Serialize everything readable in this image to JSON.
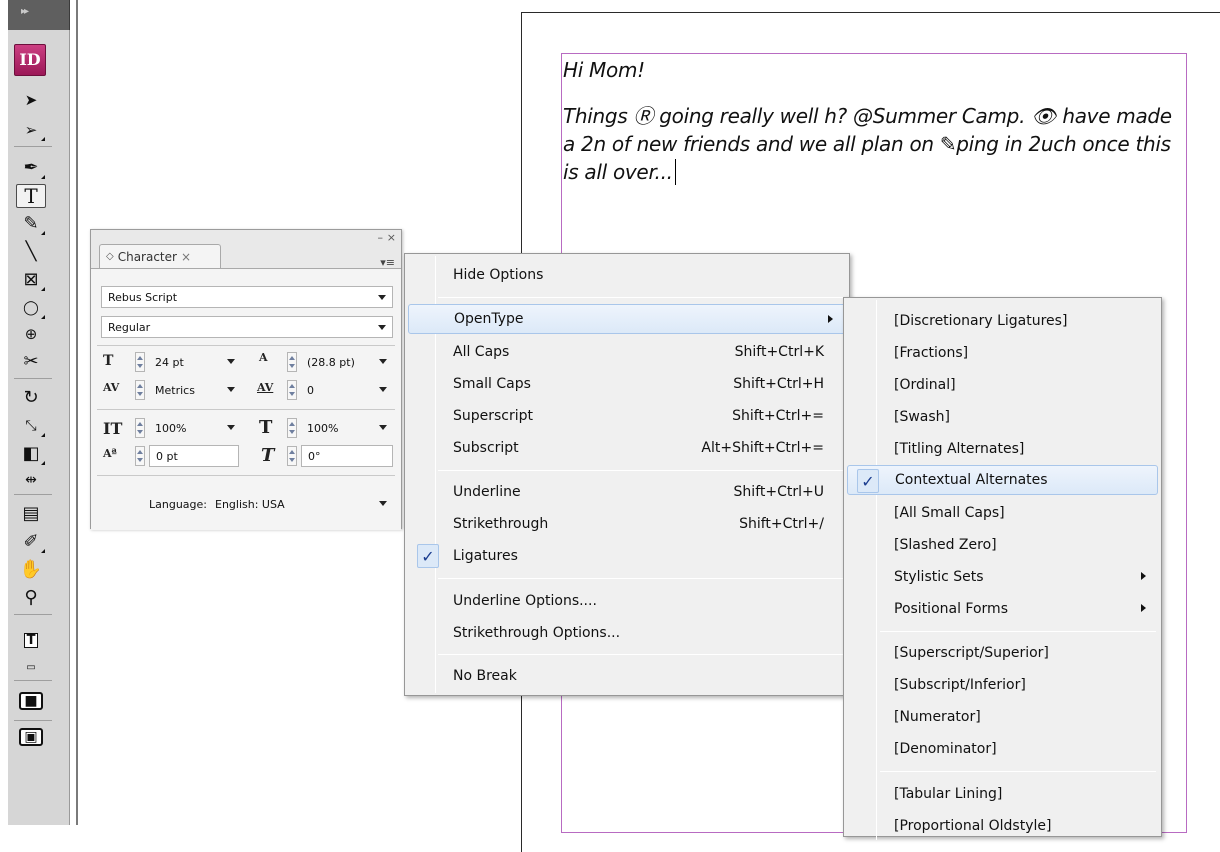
{
  "toolbar": {
    "collapse_glyph": "▸▸",
    "app_logo": "ID",
    "tools": [
      {
        "name": "selection-tool",
        "glyph": "➤"
      },
      {
        "name": "direct-selection-tool",
        "glyph": "➢"
      },
      {
        "name": "pen-tool",
        "glyph": "✒"
      },
      {
        "name": "type-tool",
        "glyph": "T"
      },
      {
        "name": "pencil-tool",
        "glyph": "✎"
      },
      {
        "name": "line-tool",
        "glyph": "╲"
      },
      {
        "name": "rectangle-frame-tool",
        "glyph": "⊠"
      },
      {
        "name": "ellipse-tool",
        "glyph": "◯"
      },
      {
        "name": "scissors-tool",
        "glyph": "✂"
      },
      {
        "name": "rotate-tool",
        "glyph": "↻"
      },
      {
        "name": "gradient-tool",
        "glyph": "◧"
      },
      {
        "name": "note-tool",
        "glyph": "▤"
      },
      {
        "name": "eyedropper-tool",
        "glyph": "✐"
      },
      {
        "name": "hand-tool",
        "glyph": "✋"
      },
      {
        "name": "zoom-tool",
        "glyph": "⚲"
      },
      {
        "name": "fill-stroke-swatch",
        "glyph": "T"
      },
      {
        "name": "format-affects-text",
        "glyph": "▭"
      },
      {
        "name": "normal-view-mode",
        "glyph": "■"
      },
      {
        "name": "screen-mode",
        "glyph": "▣"
      }
    ]
  },
  "document": {
    "paragraph1": "Hi Mom!",
    "paragraph2": "Things Ⓡ going really well h? @Summer Camp. 👁 have made a 2n of new friends and we all plan on ✎ping in 2uch once this is all over..."
  },
  "character_panel": {
    "tab_label": "Character",
    "tab_icon": "◇",
    "tab_close": "×",
    "minimize": "–",
    "close": "×",
    "menu_icon": "▾≡",
    "font_family": "Rebus Script",
    "font_style": "Regular",
    "font_size": "24 pt",
    "leading": "(28.8 pt)",
    "kerning": "Metrics",
    "tracking": "0",
    "vertical_scale": "100%",
    "horizontal_scale": "100%",
    "baseline_shift": "0 pt",
    "skew": "0°",
    "language_label": "Language:",
    "language": "English: USA"
  },
  "context_menu": {
    "items": [
      {
        "label": "Hide Options",
        "shortcut": ""
      },
      {
        "label": "OpenType",
        "shortcut": "",
        "submenu": true
      },
      {
        "label": "All Caps",
        "shortcut": "Shift+Ctrl+K"
      },
      {
        "label": "Small Caps",
        "shortcut": "Shift+Ctrl+H"
      },
      {
        "label": "Superscript",
        "shortcut": "Shift+Ctrl+="
      },
      {
        "label": "Subscript",
        "shortcut": "Alt+Shift+Ctrl+="
      },
      {
        "label": "Underline",
        "shortcut": "Shift+Ctrl+U"
      },
      {
        "label": "Strikethrough",
        "shortcut": "Shift+Ctrl+/"
      },
      {
        "label": "Ligatures",
        "shortcut": "",
        "checked": true
      },
      {
        "label": "Underline Options....",
        "shortcut": ""
      },
      {
        "label": "Strikethrough Options...",
        "shortcut": ""
      },
      {
        "label": "No Break",
        "shortcut": ""
      }
    ],
    "check_glyph": "✓"
  },
  "opentype_submenu": {
    "items": [
      {
        "label": "[Discretionary Ligatures]"
      },
      {
        "label": "[Fractions]"
      },
      {
        "label": "[Ordinal]"
      },
      {
        "label": "[Swash]"
      },
      {
        "label": "[Titling Alternates]"
      },
      {
        "label": "Contextual Alternates",
        "checked": true
      },
      {
        "label": "[All Small Caps]"
      },
      {
        "label": "[Slashed Zero]"
      },
      {
        "label": "Stylistic Sets",
        "submenu": true
      },
      {
        "label": "Positional Forms",
        "submenu": true
      },
      {
        "label": "[Superscript/Superior]"
      },
      {
        "label": "[Subscript/Inferior]"
      },
      {
        "label": "[Numerator]"
      },
      {
        "label": "[Denominator]"
      },
      {
        "label": "[Tabular Lining]"
      },
      {
        "label": "[Proportional Oldstyle]"
      }
    ]
  }
}
